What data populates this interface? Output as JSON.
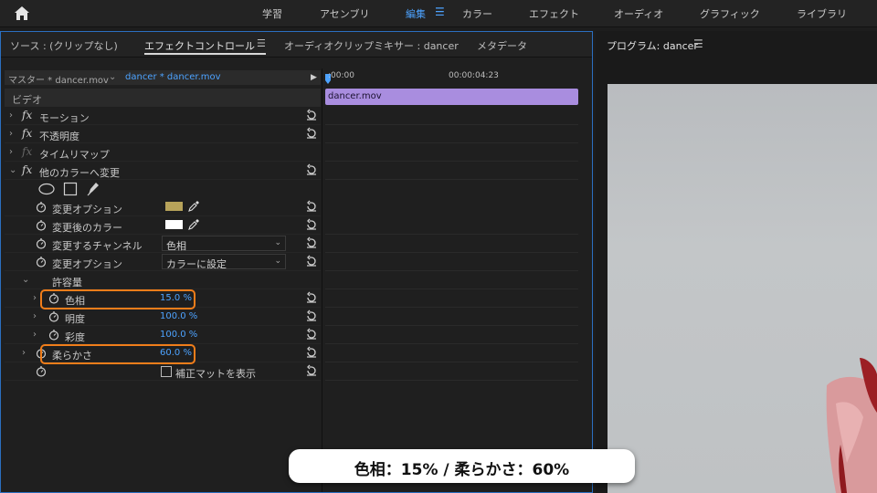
{
  "topbar": {
    "tabs": [
      "学習",
      "アセンブリ",
      "編集",
      "カラー",
      "エフェクト",
      "オーディオ",
      "グラフィック",
      "ライブラリ"
    ],
    "active_tab": "編集",
    "menu_glyph": "☰",
    "home_icon": "home-icon"
  },
  "panel": {
    "tabs": [
      "ソース : (クリップなし)",
      "エフェクトコントロール",
      "オーディオクリップミキサー : dancer",
      "メタデータ"
    ],
    "menu_glyph": "☰",
    "source_master": "マスター * dancer.mov",
    "source_clip": "dancer * dancer.mov",
    "play_glyph": "▶"
  },
  "effects": {
    "video_header": "ビデオ",
    "motion": "モーション",
    "opacity": "不透明度",
    "time_remap": "タイムリマップ",
    "change_to_color": "他のカラーへ変更",
    "from_label": "変更オプション",
    "from_color": "#b7a35a",
    "to_label": "変更後のカラー",
    "to_color": "#ffffff",
    "channel_label": "変更するチャンネル",
    "channel_value": "色相",
    "change_label": "変更オプション",
    "change_value": "カラーに設定",
    "tolerance": "許容量",
    "hue_label": "色相",
    "hue_value": "15.0 %",
    "lightness_label": "明度",
    "lightness_value": "100.0 %",
    "saturation_label": "彩度",
    "saturation_value": "100.0 %",
    "softness_label": "柔らかさ",
    "softness_value": "60.0 %",
    "matte_label": "補正マットを表示",
    "fx_glyph": "fx",
    "chevron_right": "›",
    "chevron_down": "⌄",
    "dd_arrow": "⌄"
  },
  "timeline": {
    "t0": ":00:00",
    "t1": "00:00:04:23",
    "clip_name": "dancer.mov",
    "clip_color": "#a98ddf"
  },
  "monitor": {
    "title": "プログラム: dancer",
    "menu_glyph": "☰"
  },
  "caption": {
    "text": "色相：15% / 柔らかさ：60%"
  },
  "colors": {
    "accent": "#4da3ff",
    "highlight": "#f07d1a"
  }
}
